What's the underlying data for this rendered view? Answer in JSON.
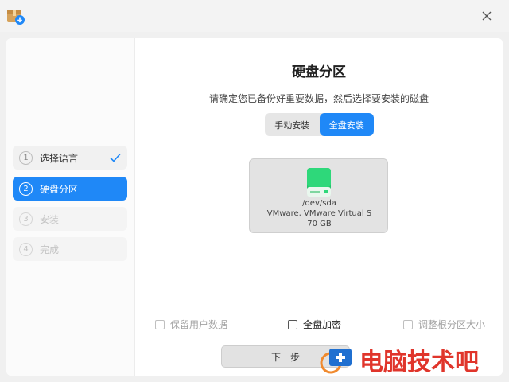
{
  "page": {
    "title": "硬盘分区",
    "subtitle": "请确定您已备份好重要数据，然后选择要安装的磁盘"
  },
  "icons": {
    "app": "installer-package-icon",
    "close": "close-icon",
    "check": "checkmark-icon",
    "disk": "hard-disk-icon"
  },
  "sidebar": {
    "steps": [
      {
        "num": "1",
        "label": "选择语言",
        "state": "done"
      },
      {
        "num": "2",
        "label": "硬盘分区",
        "state": "active"
      },
      {
        "num": "3",
        "label": "安装",
        "state": "disabled"
      },
      {
        "num": "4",
        "label": "完成",
        "state": "disabled"
      }
    ]
  },
  "tabs": [
    {
      "label": "手动安装",
      "selected": false
    },
    {
      "label": "全盘安装",
      "selected": true
    }
  ],
  "disk": {
    "path": "/dev/sda",
    "model": "VMware, VMware Virtual S",
    "size": "70 GB"
  },
  "options": {
    "keep_user_data": "保留用户数据",
    "full_disk_encrypt": "全盘加密",
    "resize_root": "调整根分区大小"
  },
  "footer": {
    "next_label": "下一步"
  },
  "watermark": {
    "text": "电脑技术吧"
  },
  "colors": {
    "accent": "#1f88f7",
    "disk_green": "#2ecc71",
    "watermark_red": "#e0352b"
  }
}
